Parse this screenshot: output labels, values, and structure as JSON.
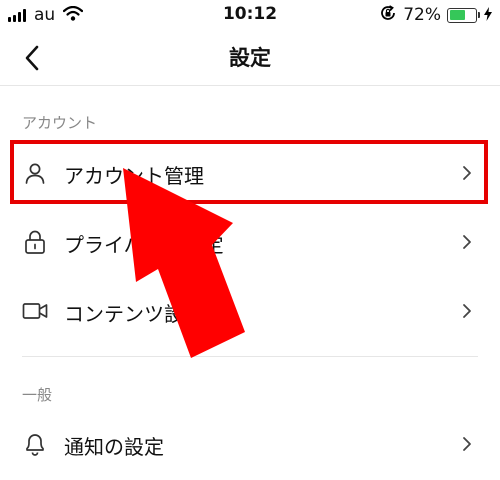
{
  "status_bar": {
    "carrier": "au",
    "time": "10:12",
    "battery_percent": "72%",
    "battery_level": 0.72,
    "icons": [
      "signal-icon",
      "wifi-icon",
      "rotation-lock-icon",
      "battery-icon",
      "charging-bolt-icon"
    ]
  },
  "header": {
    "title": "設定",
    "back_icon": "chevron-left-icon"
  },
  "sections": [
    {
      "title": "アカウント",
      "items": [
        {
          "label": "アカウント管理",
          "icon": "person-icon"
        },
        {
          "label": "プライバシー設定",
          "icon": "lock-icon"
        },
        {
          "label": "コンテンツ設定",
          "icon": "video-camera-icon"
        }
      ]
    },
    {
      "title": "一般",
      "items": [
        {
          "label": "通知の設定",
          "icon": "bell-icon"
        }
      ]
    }
  ],
  "annotation": {
    "highlight_color": "#e60000",
    "arrow_color": "#ff0000"
  }
}
